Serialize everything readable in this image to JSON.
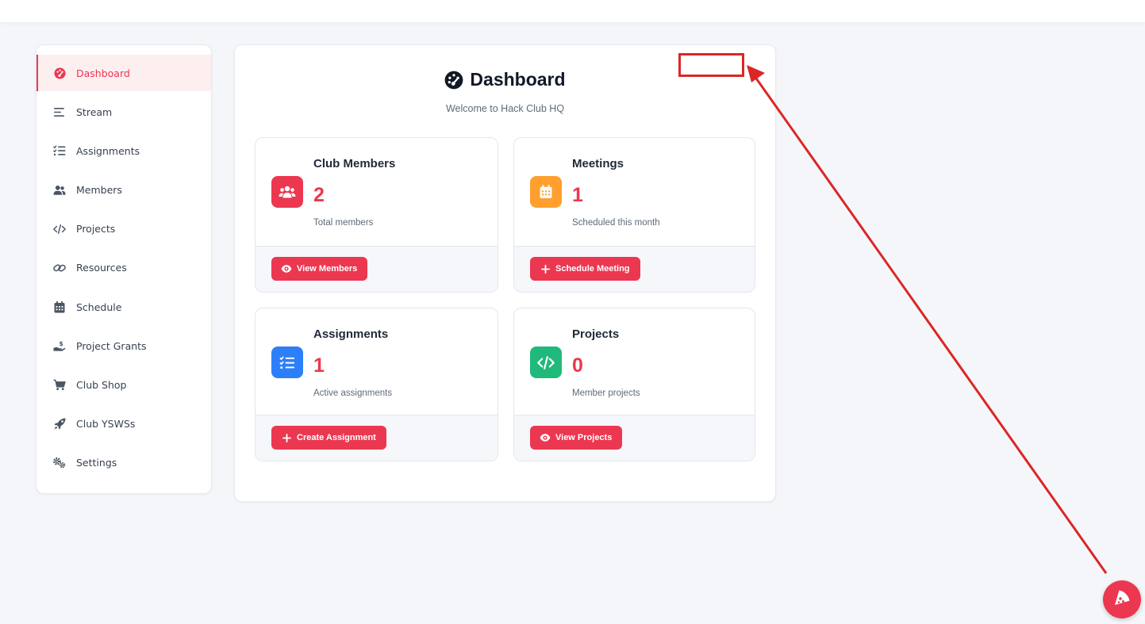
{
  "sidebar": {
    "items": [
      {
        "label": "Dashboard",
        "icon": "dashboard-gauge-icon",
        "active": true
      },
      {
        "label": "Stream",
        "icon": "stream-lines-icon"
      },
      {
        "label": "Assignments",
        "icon": "checklist-icon"
      },
      {
        "label": "Members",
        "icon": "users-icon"
      },
      {
        "label": "Projects",
        "icon": "code-icon"
      },
      {
        "label": "Resources",
        "icon": "link-icon"
      },
      {
        "label": "Schedule",
        "icon": "calendar-icon"
      },
      {
        "label": "Project Grants",
        "icon": "hand-dollar-icon"
      },
      {
        "label": "Club Shop",
        "icon": "cart-icon"
      },
      {
        "label": "Club YSWSs",
        "icon": "rocket-icon"
      },
      {
        "label": "Settings",
        "icon": "gears-icon"
      }
    ]
  },
  "main": {
    "title": "Dashboard",
    "title_icon": "dashboard-gauge-icon",
    "subtitle": "Welcome to Hack Club HQ",
    "cards": [
      {
        "title": "Club Members",
        "value": "2",
        "caption": "Total members",
        "icon": "users-icon",
        "icon_color": "#ec3750",
        "button": "View Members",
        "button_icon": "eye-icon"
      },
      {
        "title": "Meetings",
        "value": "1",
        "caption": "Scheduled this month",
        "icon": "calendar-icon",
        "icon_color": "#ff9f2e",
        "button": "Schedule Meeting",
        "button_icon": "plus-icon"
      },
      {
        "title": "Assignments",
        "value": "1",
        "caption": "Active assignments",
        "icon": "checklist-icon",
        "icon_color": "#2d7ff9",
        "button": "Create Assignment",
        "button_icon": "plus-icon"
      },
      {
        "title": "Projects",
        "value": "0",
        "caption": "Member projects",
        "icon": "code-icon",
        "icon_color": "#20b97c",
        "button": "View Projects",
        "button_icon": "eye-icon"
      }
    ]
  },
  "colors": {
    "accent": "#ec3750",
    "annotation": "#dc2626",
    "background": "#f4f6fa"
  },
  "fab": {
    "icon": "pizza-icon"
  }
}
